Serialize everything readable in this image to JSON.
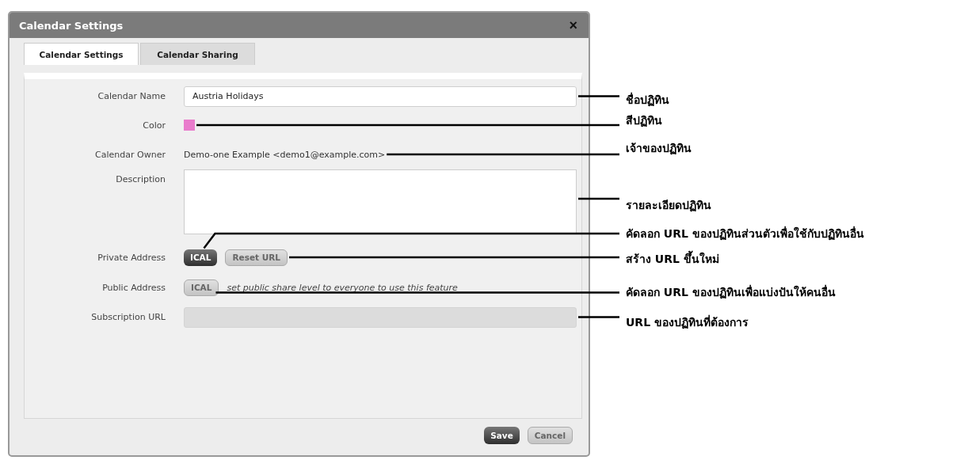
{
  "dialog": {
    "title": "Calendar Settings",
    "close": "×",
    "tabs": [
      {
        "label": "Calendar Settings",
        "selected": true
      },
      {
        "label": "Calendar Sharing",
        "selected": false
      }
    ],
    "fields": [
      {
        "kind": "input",
        "label": "Calendar Name",
        "value": "Austria Holidays"
      },
      {
        "kind": "color",
        "label": "Color",
        "color": "#e97ccc"
      },
      {
        "kind": "text",
        "label": "Calendar Owner",
        "value": "Demo-one Example <demo1@example.com>"
      },
      {
        "kind": "textarea",
        "label": "Description"
      },
      {
        "kind": "buttons",
        "label": "Private Address",
        "buttons": [
          {
            "label": "ICAL",
            "disabled": false
          },
          {
            "label": "Reset URL",
            "disabled": true
          }
        ]
      },
      {
        "kind": "buttons",
        "label": "Public Address",
        "buttons": [
          {
            "label": "ICAL",
            "disabled": true
          }
        ],
        "note": "set public share level to everyone to use this feature"
      },
      {
        "kind": "input",
        "label": "Subscription URL",
        "disabled": true
      }
    ],
    "footer_buttons": [
      {
        "label": "Save",
        "disabled": false
      },
      {
        "label": "Cancel",
        "disabled": true
      }
    ]
  },
  "annotations": [
    {
      "text": "ชื่อปฏิทิน"
    },
    {
      "text": "สีปฏิทิน"
    },
    {
      "text": "เจ้าของปฏิทิน"
    },
    {
      "text": "รายละเอียดปฏิทิน"
    },
    {
      "text": "คัดลอก URL ของปฏิทินส่วนตัวเพื่อใช้กับปฏิทินอื่น"
    },
    {
      "text": "สร้าง URL ขึ้นใหม่"
    },
    {
      "text": "คัดลอก URL ของปฏิทินเพื่อแบ่งปันให้คนอื่น"
    },
    {
      "text": "URL ของปฏิทินที่ต้องการ"
    }
  ]
}
